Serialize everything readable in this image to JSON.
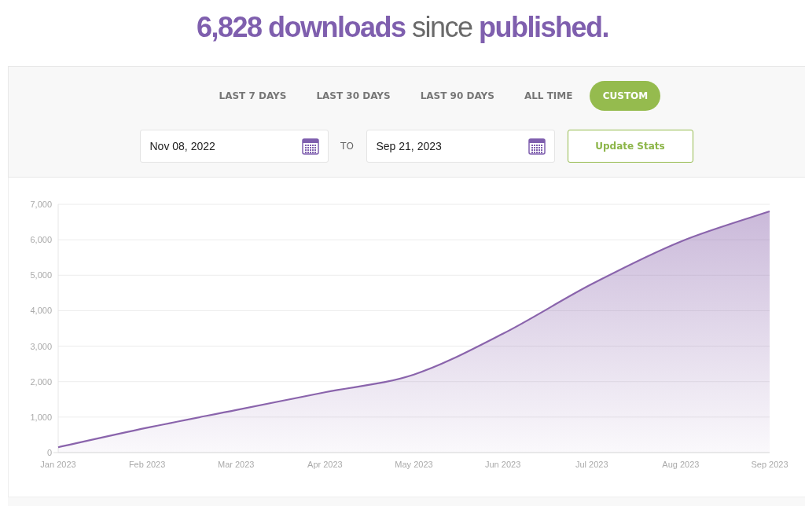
{
  "headline": "**6,828 downloads** since **published.**",
  "ranges": [
    {
      "label": "LAST 7 DAYS",
      "selected": false
    },
    {
      "label": "LAST 30 DAYS",
      "selected": false
    },
    {
      "label": "LAST 90 DAYS",
      "selected": false
    },
    {
      "label": "ALL TIME",
      "selected": false
    },
    {
      "label": "CUSTOM",
      "selected": true
    }
  ],
  "date_from": {
    "value": "Nov 08, 2022"
  },
  "to_label": "TO",
  "date_to": {
    "value": "Sep 21, 2023"
  },
  "update_button": "Update Stats",
  "chart_data": {
    "type": "area",
    "categories": [
      "Jan 2023",
      "Feb 2023",
      "Mar 2023",
      "Apr 2023",
      "May 2023",
      "Jun 2023",
      "Jul 2023",
      "Aug 2023",
      "Sep 2023"
    ],
    "series": [
      {
        "color": "#8a64ac",
        "values": [
          150,
          700,
          1200,
          1700,
          2200,
          3350,
          4750,
          5950,
          6800
        ]
      }
    ],
    "grid": true,
    "ylim": [
      0,
      7000
    ],
    "yticks": [
      {
        "value": 0,
        "label": "0"
      },
      {
        "value": 1000,
        "label": "1,000"
      },
      {
        "value": 2000,
        "label": "2,000"
      },
      {
        "value": 3000,
        "label": "3,000"
      },
      {
        "value": 4000,
        "label": "4,000"
      },
      {
        "value": 5000,
        "label": "5,000"
      },
      {
        "value": 6000,
        "label": "6,000"
      },
      {
        "value": 7000,
        "label": "7,000"
      }
    ]
  }
}
